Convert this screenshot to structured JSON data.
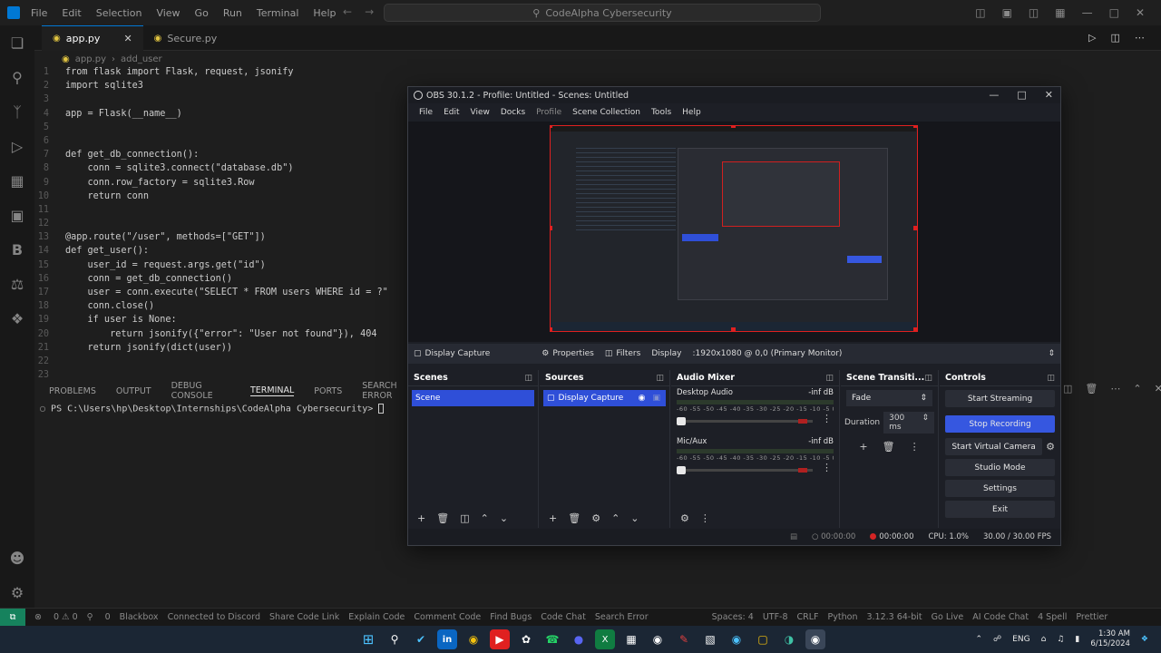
{
  "vscode": {
    "menu": [
      "File",
      "Edit",
      "Selection",
      "View",
      "Go",
      "Run",
      "Terminal",
      "Help"
    ],
    "search": "CodeAlpha Cybersecurity",
    "tabs": [
      {
        "label": "app.py",
        "active": true
      },
      {
        "label": "Secure.py",
        "active": false
      }
    ],
    "breadcrumb": [
      "app.py",
      "add_user"
    ],
    "code": [
      {
        "n": "1",
        "t": "from flask import Flask, request, jsonify"
      },
      {
        "n": "2",
        "t": "import sqlite3"
      },
      {
        "n": "3",
        "t": ""
      },
      {
        "n": "4",
        "t": "app = Flask(__name__)"
      },
      {
        "n": "5",
        "t": ""
      },
      {
        "n": "6",
        "t": ""
      },
      {
        "n": "7",
        "t": "def get_db_connection():"
      },
      {
        "n": "8",
        "t": "    conn = sqlite3.connect(\"database.db\")"
      },
      {
        "n": "9",
        "t": "    conn.row_factory = sqlite3.Row"
      },
      {
        "n": "10",
        "t": "    return conn"
      },
      {
        "n": "11",
        "t": ""
      },
      {
        "n": "12",
        "t": ""
      },
      {
        "n": "13",
        "t": "@app.route(\"/user\", methods=[\"GET\"])"
      },
      {
        "n": "14",
        "t": "def get_user():"
      },
      {
        "n": "15",
        "t": "    user_id = request.args.get(\"id\")"
      },
      {
        "n": "16",
        "t": "    conn = get_db_connection()"
      },
      {
        "n": "17",
        "t": "    user = conn.execute(\"SELECT * FROM users WHERE id = ?\""
      },
      {
        "n": "18",
        "t": "    conn.close()"
      },
      {
        "n": "19",
        "t": "    if user is None:"
      },
      {
        "n": "20",
        "t": "        return jsonify({\"error\": \"User not found\"}), 404"
      },
      {
        "n": "21",
        "t": "    return jsonify(dict(user))"
      },
      {
        "n": "22",
        "t": ""
      },
      {
        "n": "23",
        "t": ""
      }
    ],
    "panel_tabs": [
      "PROBLEMS",
      "OUTPUT",
      "DEBUG CONSOLE",
      "TERMINAL",
      "PORTS",
      "SEARCH ERROR"
    ],
    "active_panel_tab": "TERMINAL",
    "terminal_prompt": "PS C:\\Users\\hp\\Desktop\\Internships\\CodeAlpha Cybersecurity> ",
    "status": {
      "problems": "0 ⚠ 0",
      "ports": "0",
      "blackbox": "Blackbox",
      "discord": "Connected to Discord",
      "share": "Share Code Link",
      "explain": "Explain Code",
      "comment": "Comment Code",
      "bugs": "Find Bugs",
      "chat": "Code Chat",
      "search_error": "Search Error",
      "position": "Spaces: 4",
      "encoding": "UTF-8",
      "eol": "CRLF",
      "language": "Python",
      "interpreter": "3.12.3 64-bit",
      "golive": "Go Live",
      "ai_chat": "AI Code Chat",
      "spell": "4 Spell",
      "prettier": "Prettier"
    }
  },
  "obs": {
    "title": "OBS 30.1.2 - Profile: Untitled - Scenes: Untitled",
    "menu": [
      "File",
      "Edit",
      "View",
      "Docks",
      "Profile",
      "Scene Collection",
      "Tools",
      "Help"
    ],
    "source_bar": {
      "source": "Display Capture",
      "properties": "Properties",
      "filters": "Filters",
      "display_label": "Display",
      "display_value": ":1920x1080 @ 0,0 (Primary Monitor)"
    },
    "scenes": {
      "header": "Scenes",
      "items": [
        "Scene"
      ]
    },
    "sources": {
      "header": "Sources",
      "items": [
        "Display Capture"
      ]
    },
    "mixer": {
      "header": "Audio Mixer",
      "channels": [
        {
          "name": "Desktop Audio",
          "level": "-inf dB"
        },
        {
          "name": "Mic/Aux",
          "level": "-inf dB"
        }
      ],
      "ticks": "-60 -55 -50 -45 -40 -35 -30 -25 -20 -15 -10 -5 0"
    },
    "transitions": {
      "header": "Scene Transiti...",
      "type": "Fade",
      "duration_label": "Duration",
      "duration_value": "300 ms"
    },
    "controls": {
      "header": "Controls",
      "start_streaming": "Start Streaming",
      "stop_recording": "Stop Recording",
      "start_virtual_camera": "Start Virtual Camera",
      "studio_mode": "Studio Mode",
      "settings": "Settings",
      "exit": "Exit"
    },
    "status": {
      "stream_time": "00:00:00",
      "rec_time": "00:00:00",
      "cpu": "CPU: 1.0%",
      "fps": "30.00 / 30.00 FPS"
    }
  },
  "taskbar": {
    "lang": "ENG",
    "time": "1:30 AM",
    "date": "6/15/2024"
  }
}
